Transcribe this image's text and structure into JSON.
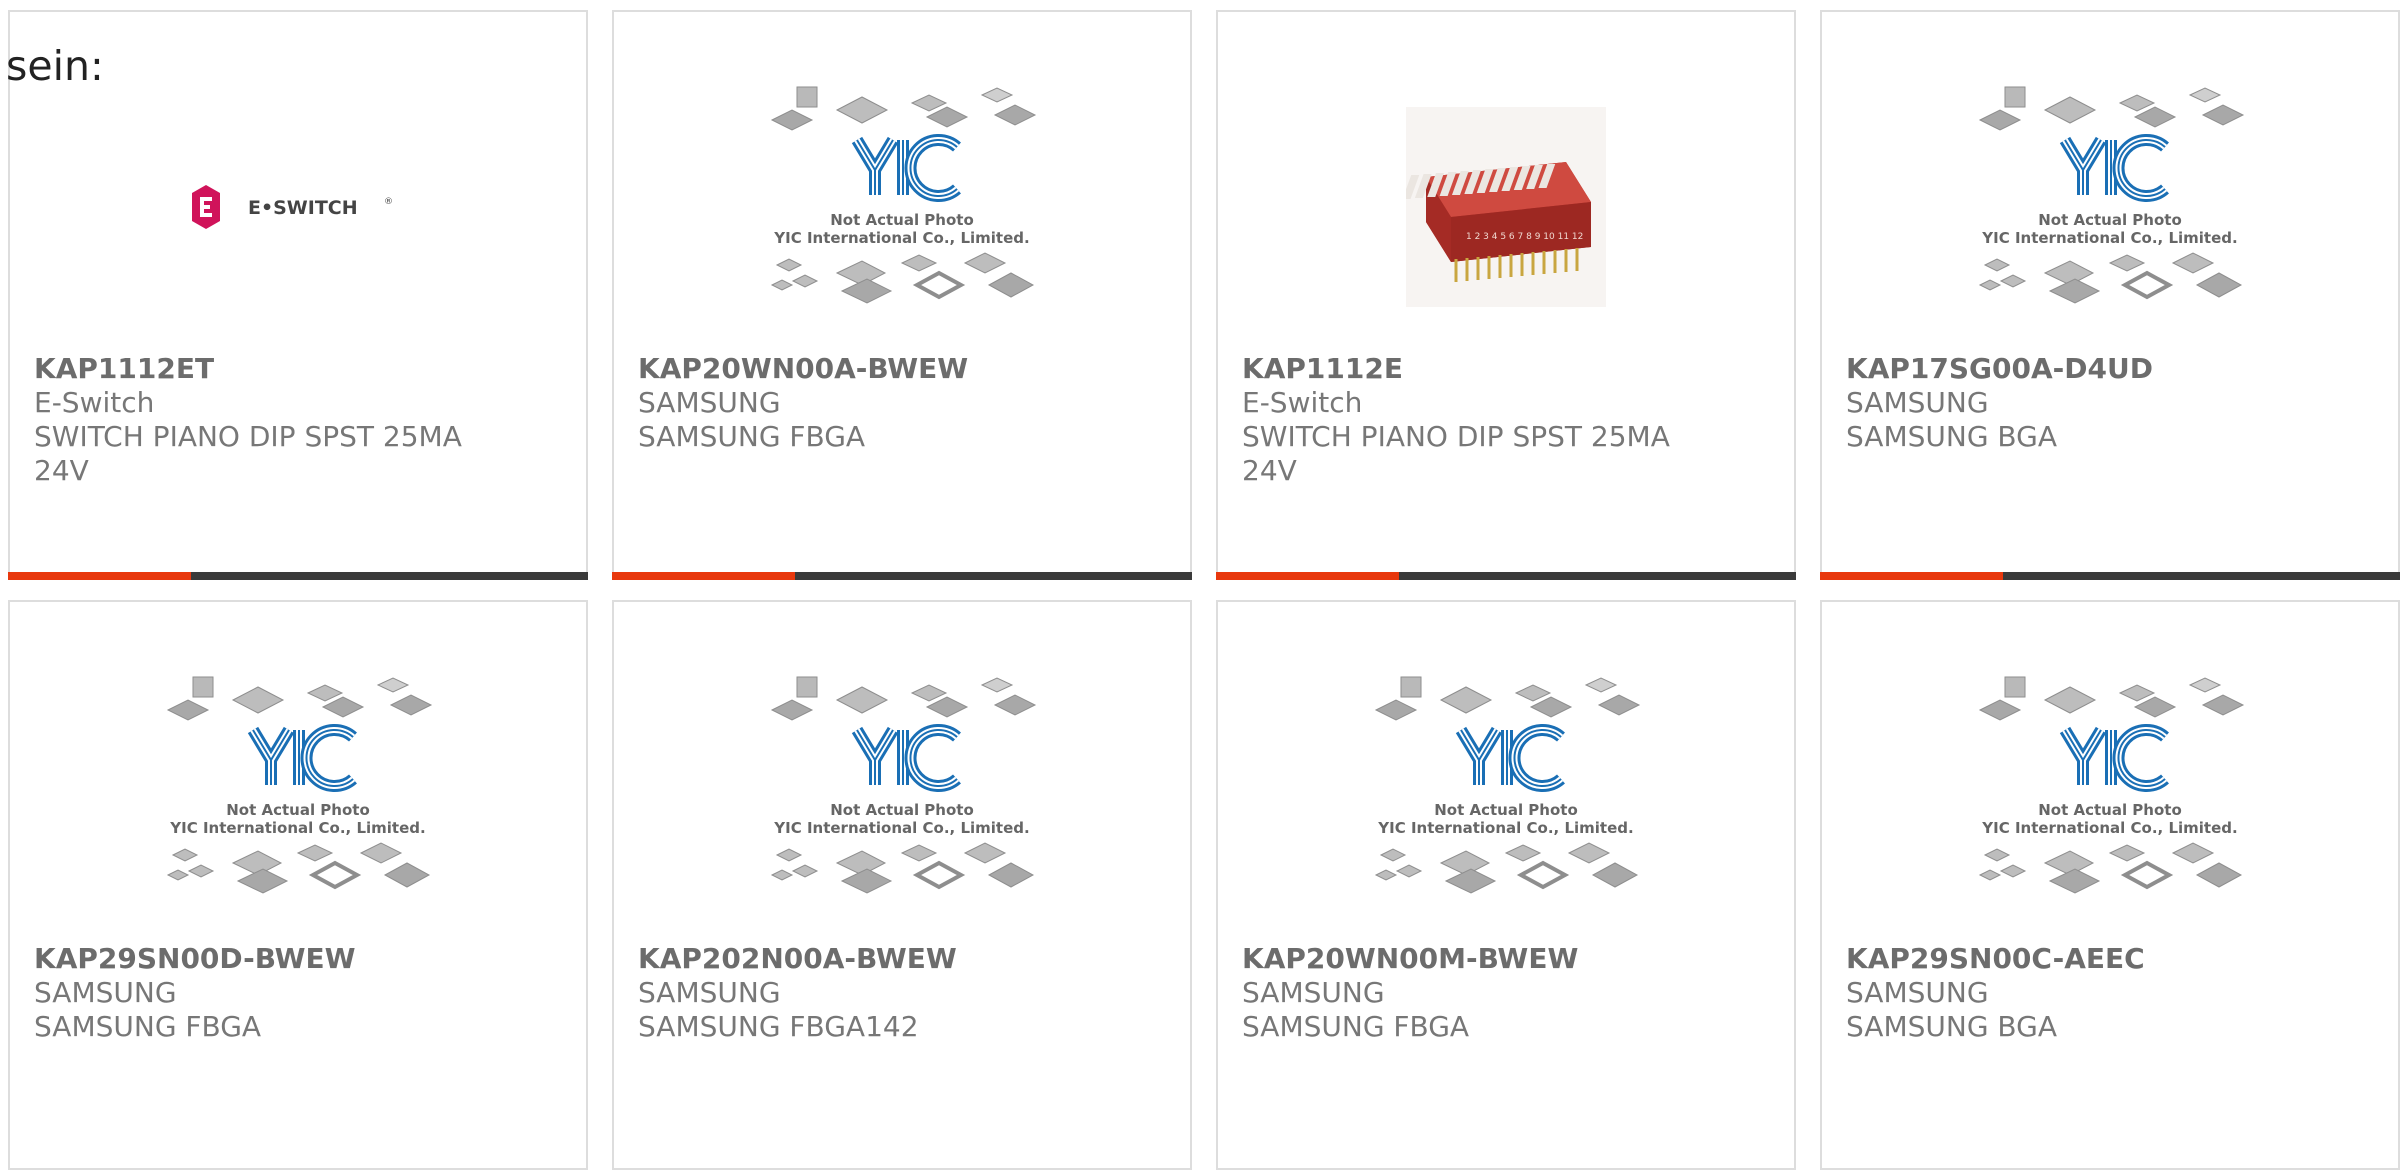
{
  "heading": "sein:",
  "placeholder": {
    "logo_text": "YIC",
    "line1": "Not Actual Photo",
    "line2": "YIC International Co., Limited."
  },
  "eswitch_logo_text": "E•SWITCH",
  "eswitch_logo_mark": "®",
  "dip_switch_numbers": "1 2 3 4 5 6 7 8 9 10 11 12",
  "products": [
    {
      "part": "KAP1112ET",
      "maker": "E-Switch",
      "desc": "SWITCH PIANO DIP SPST 25MA 24V",
      "image": "e-switch-logo"
    },
    {
      "part": "KAP20WN00A-BWEW",
      "maker": "SAMSUNG",
      "desc": "SAMSUNG FBGA",
      "image": "yic-placeholder"
    },
    {
      "part": "KAP1112E",
      "maker": "E-Switch",
      "desc": "SWITCH PIANO DIP SPST 25MA 24V",
      "image": "dip-switch-photo"
    },
    {
      "part": "KAP17SG00A-D4UD",
      "maker": "SAMSUNG",
      "desc": "SAMSUNG BGA",
      "image": "yic-placeholder"
    },
    {
      "part": "KAP29SN00D-BWEW",
      "maker": "SAMSUNG",
      "desc": "SAMSUNG FBGA",
      "image": "yic-placeholder"
    },
    {
      "part": "KAP202N00A-BWEW",
      "maker": "SAMSUNG",
      "desc": "SAMSUNG FBGA142",
      "image": "yic-placeholder"
    },
    {
      "part": "KAP20WN00M-BWEW",
      "maker": "SAMSUNG",
      "desc": "SAMSUNG FBGA",
      "image": "yic-placeholder"
    },
    {
      "part": "KAP29SN00C-AEEC",
      "maker": "SAMSUNG",
      "desc": "SAMSUNG BGA",
      "image": "yic-placeholder"
    }
  ],
  "colors": {
    "accent": "#e8380d",
    "bar": "#3a3a3a",
    "yic_blue": "#1a6fb5",
    "eswitch_pink": "#d0135a",
    "text": "#777777"
  }
}
